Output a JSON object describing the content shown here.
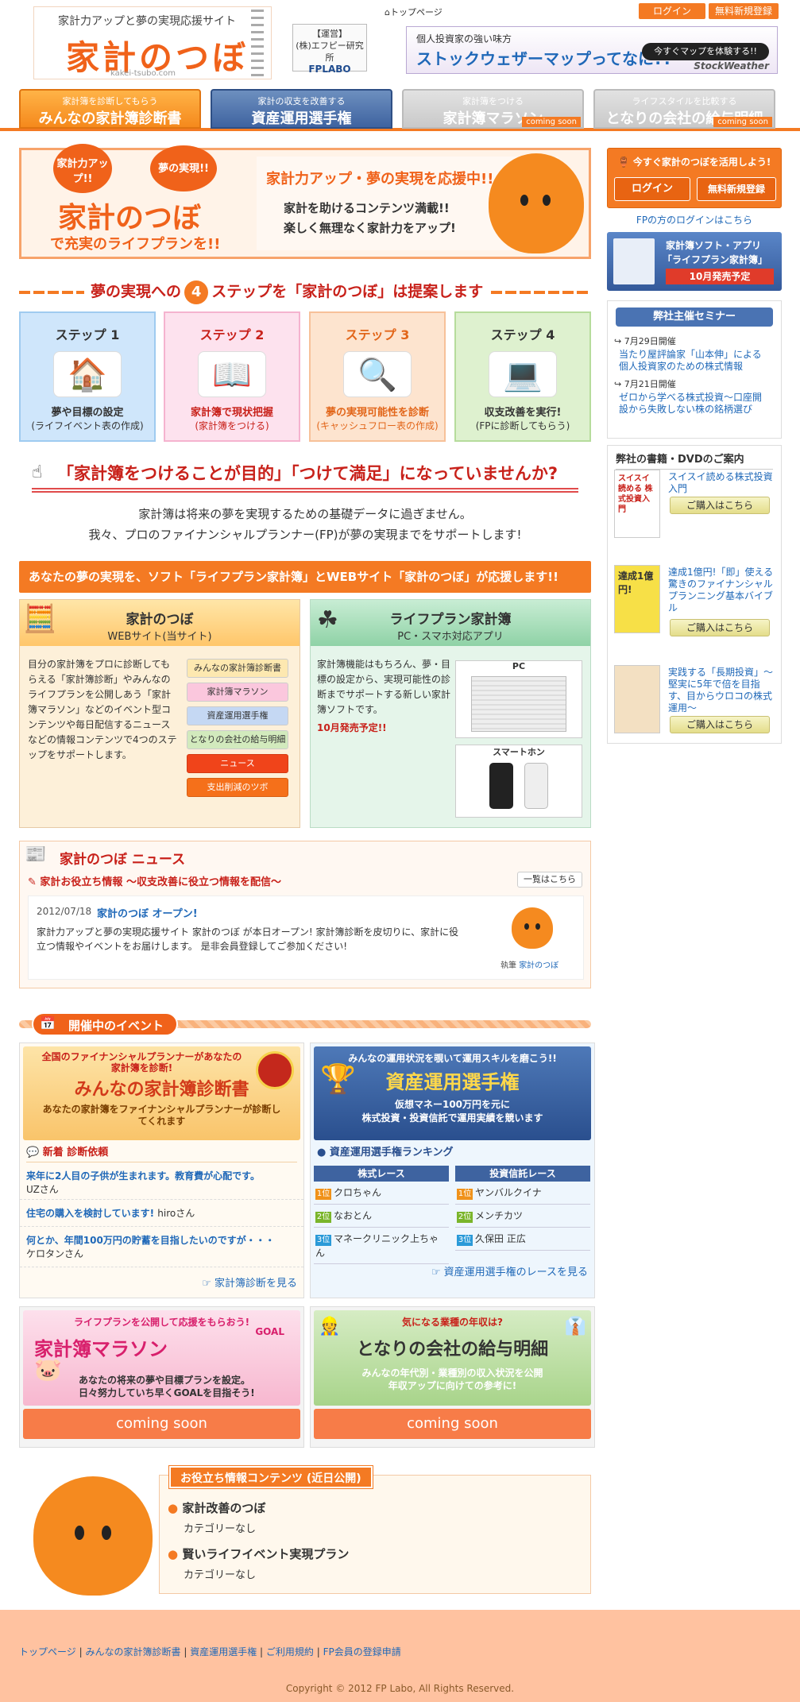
{
  "header": {
    "tagline": "家計力アップと夢の実現応援サイト",
    "site_name": "家計のつぼ",
    "site_url": "kakei-tsubo.com",
    "operator_label": "【運営】",
    "operator_name": "(株)エフピー研究所",
    "operator_logo": "FPLABO",
    "top_link": "トップページ",
    "login": "ログイン",
    "signup": "無料新規登録",
    "ad_line1": "個人投資家の強い味方",
    "ad_line2": "ストックウェザーマップってなに??",
    "ad_button": "今すぐマップを体験する!!",
    "ad_brand": "StockWeather"
  },
  "nav": [
    {
      "sub": "家計簿を診断してもらう",
      "label": "みんなの家計簿診断書",
      "badge": ""
    },
    {
      "sub": "家計の収支を改善する",
      "label": "資産運用選手権",
      "badge": ""
    },
    {
      "sub": "家計簿をつける",
      "label": "家計簿マラソン",
      "badge": "coming soon"
    },
    {
      "sub": "ライフスタイルを比較する",
      "label": "となりの会社の給与明細",
      "badge": "coming soon"
    }
  ],
  "hero": {
    "bubble1": "家計力アップ!!",
    "bubble2": "夢の実現!!",
    "name": "家計のつぼ",
    "tail": "で充実のライフプランを!!",
    "headline": "家計力アップ・夢の実現を応援中!!",
    "line1": "家計を助けるコンテンツ満載!!",
    "line2": "楽しく無理なく家計力をアップ!"
  },
  "steps": {
    "title_a": "夢の実現への",
    "number": "4",
    "title_b": "ステップを「家計のつぼ」は提案します",
    "items": [
      {
        "label": "ステップ",
        "num": "1",
        "l1": "夢や目標の設定",
        "l2": "(ライフイベント表の作成)"
      },
      {
        "label": "ステップ",
        "num": "2",
        "l1": "家計簿で現状把握",
        "l2": "(家計簿をつける)"
      },
      {
        "label": "ステップ",
        "num": "3",
        "l1": "夢の実現可能性を診断",
        "l2": "(キャッシュフロー表の作成)"
      },
      {
        "label": "ステップ",
        "num": "4",
        "l1": "収支改善を実行!",
        "l2": "(FPに診断してもらう)"
      }
    ]
  },
  "warning": {
    "title": "「家計簿をつけることが目的」「つけて満足」になっていませんか?",
    "body1": "家計簿は将来の夢を実現するための基礎データに過ぎません。",
    "body2": "我々、プロのファイナンシャルプランナー(FP)が夢の実現までをサポートします!"
  },
  "support_bar": "あなたの夢の実現を、ソフト「ライフプラン家計簿」とWEBサイト「家計のつぼ」が応援します!!",
  "web_panel": {
    "title": "家計のつぼ",
    "subtitle": "WEBサイト(当サイト)",
    "body": "目分の家計簿をプロに診断してもらえる「家計簿診断」やみんなのライフプランを公開しあう「家計簿マラソン」などのイベント型コンテンツや毎日配信するニュースなどの情報コンテンツで4つのステップをサポートします。",
    "buttons": [
      "みんなの家計簿診断書",
      "家計簿マラソン",
      "資産運用選手権",
      "となりの会社の給与明細",
      "ニュース",
      "支出削減のツボ"
    ]
  },
  "app_panel": {
    "title": "ライフプラン家計簿",
    "subtitle": "PC・スマホ対応アプリ",
    "body": "家計簿機能はもちろん、夢・目標の設定から、実現可能性の診断までサポートする新しい家計簿ソフトです。",
    "release": "10月発売予定!!",
    "pc": "PC",
    "phone": "スマートホン"
  },
  "news": {
    "title": "家計のつぼ ニュース",
    "sub": "家計お役立ち情報 〜収支改善に役立つ情報を配信〜",
    "more": "一覧はこちら",
    "date": "2012/07/18",
    "headline": "家計のつぼ オープン!",
    "body": "家計力アップと夢の実現応援サイト 家計のつぼ が本日オープン! 家計簿診断を皮切りに、家計に役立つ情報やイベントをお届けします。 是非会員登録してご参加ください!",
    "author_label": "執筆",
    "author": "家計のつぼ"
  },
  "events": {
    "title": "開催中のイベント",
    "shindan": {
      "top": "全国のファイナンシャルプランナーがあなたの家計簿を診断!",
      "name": "みんなの家計簿診断書",
      "bottom": "あなたの家計簿をファイナンシャルプランナーが診断してくれます",
      "list_title": "新着 診断依頼",
      "items": [
        {
          "q": "来年に2人目の子供が生まれます。教育費が心配です。",
          "u": "UZさん"
        },
        {
          "q": "住宅の購入を検討しています!",
          "u": "hiroさん"
        },
        {
          "q": "何とか、年間100万円の貯蓄を目指したいのですが・・・",
          "u": "ケロタンさん"
        }
      ],
      "more": "家計簿診断を見る"
    },
    "senshuken": {
      "top": "みんなの運用状況を覗いて運用スキルを磨こう!!",
      "name": "資産運用選手権",
      "bottom1": "仮想マネー100万円を元に",
      "bottom2": "株式投資・投資信託で運用実績を競います",
      "rank_title": "資産運用選手権ランキング",
      "stock_title": "株式レース",
      "fund_title": "投資信託レース",
      "rank_label": "位",
      "stock": [
        "クロちゃん",
        "なおとん",
        "マネークリニック上ちゃん"
      ],
      "fund": [
        "ヤンバルクイナ",
        "メンチカツ",
        "久保田 正広"
      ],
      "more": "資産運用選手権のレースを見る"
    },
    "marathon": {
      "top": "ライフプランを公開して応援をもらおう!",
      "name": "家計簿マラソン",
      "goal": "GOAL",
      "b1": "あなたの将来の夢や目標プランを設定。",
      "b2": "日々努力していち早くGOALを目指そう!",
      "button": "coming soon"
    },
    "kyuyo": {
      "top": "気になる業種の年収は?",
      "name": "となりの会社の給与明細",
      "b1": "みんなの年代別・業種別の収入状況を公開",
      "b2": "年収アップに向けての参考に!",
      "button": "coming soon"
    }
  },
  "useful": {
    "title": "お役立ち情報コンテンツ (近日公開)",
    "items": [
      {
        "name": "家計改善のつぼ",
        "cat": "カテゴリーなし"
      },
      {
        "name": "賢いライフイベント実現プラン",
        "cat": "カテゴリーなし"
      }
    ]
  },
  "sidebar": {
    "cta": "今すぐ家計のつぼを活用しよう!",
    "login": "ログイン",
    "signup": "無料新規登録",
    "fp_login": "FPの方のログインはこちら",
    "soft_l1": "家計簿ソフト・アプリ",
    "soft_l2": "「ライフプラン家計簿」",
    "soft_l3": "10月発売予定",
    "seminar_title": "弊社主催セミナー",
    "seminars": [
      {
        "date": "7月29日開催",
        "title": "当たり屋評論家「山本伸」による個人投資家のための株式情報"
      },
      {
        "date": "7月21日開催",
        "title": "ゼロから学べる株式投資〜口座開設から失敗しない株の銘柄選び"
      }
    ],
    "books_title": "弊社の書籍・DVDのご案内",
    "books": [
      {
        "cover": "スイスイ読める 株式投資入門",
        "title": "スイスイ読める株式投資入門",
        "buy": "ご購入はこちら"
      },
      {
        "cover": "達成1億円!",
        "title": "達成1億円!「即」使える驚きのファイナンシャルプランニング基本バイブル",
        "buy": "ご購入はこちら"
      },
      {
        "cover": "",
        "title": "実践する「長期投資」〜堅実に5年で倍を目指す、目からウロコの株式運用〜",
        "buy": "ご購入はこちら"
      }
    ]
  },
  "footer": {
    "links": [
      "トップページ",
      "みんなの家計簿診断書",
      "資産運用選手権",
      "ご利用規約",
      "FP会員の登録申請"
    ],
    "sep": "|",
    "copyright": "Copyright © 2012 FP Labo, All Rights Reserved."
  },
  "colors": {
    "accent": "#f47a23",
    "link": "#1f68b8",
    "red": "#c8211a",
    "navy": "#3e63a0"
  }
}
